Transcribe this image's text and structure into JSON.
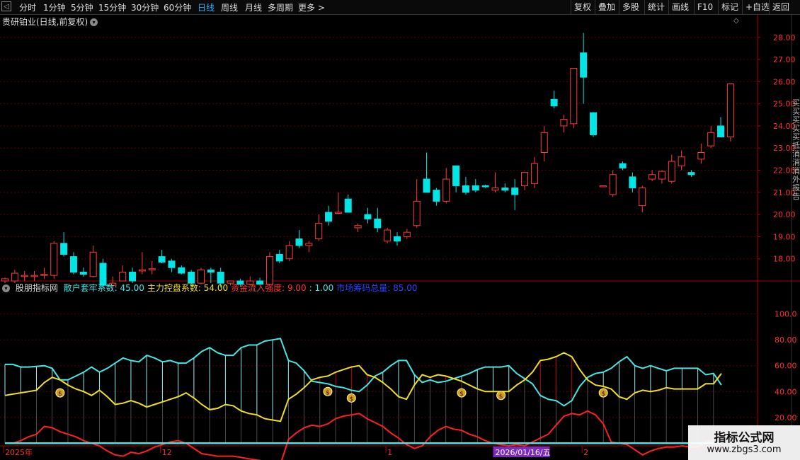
{
  "toolbar": {
    "back_glyph": "◁",
    "periods": [
      {
        "label": "分时",
        "active": false
      },
      {
        "label": "1分钟",
        "active": false
      },
      {
        "label": "5分钟",
        "active": false
      },
      {
        "label": "15分钟",
        "active": false
      },
      {
        "label": "30分钟",
        "active": false
      },
      {
        "label": "60分钟",
        "active": false
      },
      {
        "label": "日线",
        "active": true
      },
      {
        "label": "周线",
        "active": false
      },
      {
        "label": "月线",
        "active": false
      },
      {
        "label": "多周期",
        "active": false
      },
      {
        "label": "更多 >",
        "active": false
      }
    ],
    "right_buttons": [
      "复权",
      "叠加",
      "多股",
      "统计",
      "画线",
      "F10",
      "标记",
      "+自选",
      "返回"
    ]
  },
  "main": {
    "title": "贵研铂业(日线,前复权)",
    "diamond_glyph": "◇"
  },
  "indicator": {
    "name": "股朋指标网",
    "items": [
      {
        "label": "散户套牢系数: 45.00",
        "color": "#44e6e6"
      },
      {
        "label": "主力控盘系数: 54.00",
        "color": "#f0e020"
      },
      {
        "label": "资金流入强度: 9.00",
        "color": "#ff3333"
      },
      {
        "label": ": 1.00",
        "color": "#44e6e6"
      },
      {
        "label": "市场筹码总量: 85.00",
        "color": "#2a44ff"
      }
    ]
  },
  "right_side_text": "买买买买买 抵消消消 外 报 告",
  "watermark": {
    "line1": "指标公式网",
    "line2": "www.zbgs3.com"
  },
  "colors": {
    "up": "#ff3b3b",
    "down": "#00e5e5",
    "grid": "#5a0000",
    "cyan": "#44e6e6",
    "yellow": "#f0e020",
    "red": "#ff2020",
    "axis": "#aa0000"
  },
  "chart_data": {
    "type": "candlestick",
    "price_axis": {
      "ticks": [
        "18.00",
        "19.00",
        "20.00",
        "21.00",
        "22.00",
        "23.00",
        "24.00",
        "25.00",
        "26.00",
        "27.00",
        "28.00"
      ],
      "ylim": [
        17.0,
        28.6
      ]
    },
    "indicator_axis": {
      "ticks": [
        "20.00",
        "40.00",
        "60.00",
        "80.00",
        "100.0"
      ],
      "ylim": [
        -2,
        125
      ]
    },
    "x_labels": [
      {
        "text": "2025年",
        "i": 0
      },
      {
        "text": "12",
        "i": 16
      },
      {
        "text": "1",
        "i": 39
      },
      {
        "text": "2026/01/16/五",
        "i": 50,
        "highlight": true
      },
      {
        "text": "2",
        "i": 59
      }
    ],
    "candles": [
      {
        "o": 17.0,
        "h": 17.15,
        "l": 16.9,
        "c": 17.1
      },
      {
        "o": 17.0,
        "h": 17.5,
        "l": 16.9,
        "c": 17.35
      },
      {
        "o": 17.2,
        "h": 17.45,
        "l": 17.0,
        "c": 17.25
      },
      {
        "o": 17.2,
        "h": 17.45,
        "l": 17.0,
        "c": 17.25
      },
      {
        "o": 17.25,
        "h": 17.6,
        "l": 17.1,
        "c": 17.3
      },
      {
        "o": 17.25,
        "h": 18.8,
        "l": 17.1,
        "c": 18.7
      },
      {
        "o": 18.7,
        "h": 19.2,
        "l": 18.1,
        "c": 18.2
      },
      {
        "o": 18.1,
        "h": 18.3,
        "l": 17.3,
        "c": 17.4
      },
      {
        "o": 17.4,
        "h": 17.6,
        "l": 17.2,
        "c": 17.3
      },
      {
        "o": 17.2,
        "h": 18.6,
        "l": 17.15,
        "c": 18.3
      },
      {
        "o": 17.8,
        "h": 18.0,
        "l": 16.7,
        "c": 16.8
      },
      {
        "o": 16.8,
        "h": 17.2,
        "l": 16.6,
        "c": 16.9
      },
      {
        "o": 17.0,
        "h": 17.7,
        "l": 17.0,
        "c": 17.4
      },
      {
        "o": 17.4,
        "h": 17.6,
        "l": 16.9,
        "c": 17.0
      },
      {
        "o": 17.45,
        "h": 18.3,
        "l": 17.3,
        "c": 17.5
      },
      {
        "o": 17.5,
        "h": 17.9,
        "l": 17.3,
        "c": 17.55
      },
      {
        "o": 18.1,
        "h": 18.4,
        "l": 17.8,
        "c": 17.85
      },
      {
        "o": 17.9,
        "h": 18.0,
        "l": 17.4,
        "c": 17.6
      },
      {
        "o": 17.6,
        "h": 17.7,
        "l": 17.3,
        "c": 17.35
      },
      {
        "o": 17.4,
        "h": 17.5,
        "l": 16.8,
        "c": 16.9
      },
      {
        "o": 16.9,
        "h": 17.6,
        "l": 16.85,
        "c": 17.5
      },
      {
        "o": 17.5,
        "h": 17.6,
        "l": 16.9,
        "c": 17.4
      },
      {
        "o": 17.4,
        "h": 17.6,
        "l": 16.7,
        "c": 16.9
      },
      {
        "o": 16.9,
        "h": 17.0,
        "l": 16.8,
        "c": 17.0
      },
      {
        "o": 17.0,
        "h": 17.1,
        "l": 16.75,
        "c": 16.85
      },
      {
        "o": 16.85,
        "h": 17.2,
        "l": 16.8,
        "c": 17.0
      },
      {
        "o": 17.0,
        "h": 17.15,
        "l": 16.8,
        "c": 16.85
      },
      {
        "o": 16.85,
        "h": 18.3,
        "l": 16.8,
        "c": 18.1
      },
      {
        "o": 18.2,
        "h": 18.4,
        "l": 17.8,
        "c": 17.9
      },
      {
        "o": 18.0,
        "h": 18.8,
        "l": 17.9,
        "c": 18.6
      },
      {
        "o": 18.9,
        "h": 19.3,
        "l": 18.5,
        "c": 18.6
      },
      {
        "o": 18.6,
        "h": 18.8,
        "l": 18.3,
        "c": 18.7
      },
      {
        "o": 18.9,
        "h": 20.0,
        "l": 18.8,
        "c": 19.6
      },
      {
        "o": 20.1,
        "h": 20.4,
        "l": 19.5,
        "c": 19.7
      },
      {
        "o": 20.1,
        "h": 21.0,
        "l": 20.0,
        "c": 20.1
      },
      {
        "o": 20.7,
        "h": 20.9,
        "l": 20.1,
        "c": 20.1
      },
      {
        "o": 19.4,
        "h": 19.6,
        "l": 19.2,
        "c": 19.5
      },
      {
        "o": 20.0,
        "h": 20.3,
        "l": 19.6,
        "c": 19.8
      },
      {
        "o": 19.8,
        "h": 20.3,
        "l": 19.2,
        "c": 19.4
      },
      {
        "o": 18.8,
        "h": 19.4,
        "l": 18.7,
        "c": 19.3
      },
      {
        "o": 19.0,
        "h": 19.2,
        "l": 18.6,
        "c": 18.8
      },
      {
        "o": 19.0,
        "h": 19.35,
        "l": 18.9,
        "c": 19.2
      },
      {
        "o": 19.5,
        "h": 21.6,
        "l": 19.4,
        "c": 20.6
      },
      {
        "o": 21.6,
        "h": 22.8,
        "l": 21.0,
        "c": 21.0
      },
      {
        "o": 21.1,
        "h": 21.2,
        "l": 20.4,
        "c": 20.6
      },
      {
        "o": 20.6,
        "h": 22.1,
        "l": 20.5,
        "c": 21.6
      },
      {
        "o": 22.2,
        "h": 22.2,
        "l": 21.0,
        "c": 21.3
      },
      {
        "o": 21.3,
        "h": 21.7,
        "l": 20.9,
        "c": 21.0
      },
      {
        "o": 21.3,
        "h": 21.6,
        "l": 21.0,
        "c": 21.1
      },
      {
        "o": 21.3,
        "h": 21.35,
        "l": 21.2,
        "c": 21.25
      },
      {
        "o": 21.1,
        "h": 21.9,
        "l": 21.0,
        "c": 21.2
      },
      {
        "o": 21.2,
        "h": 21.4,
        "l": 21.0,
        "c": 21.1
      },
      {
        "o": 21.2,
        "h": 21.6,
        "l": 20.2,
        "c": 20.9
      },
      {
        "o": 21.3,
        "h": 21.9,
        "l": 21.1,
        "c": 21.9
      },
      {
        "o": 21.4,
        "h": 22.6,
        "l": 21.2,
        "c": 22.3
      },
      {
        "o": 22.8,
        "h": 24.0,
        "l": 22.4,
        "c": 23.7
      },
      {
        "o": 25.2,
        "h": 25.6,
        "l": 24.8,
        "c": 24.9
      },
      {
        "o": 24.0,
        "h": 24.5,
        "l": 23.7,
        "c": 24.3
      },
      {
        "o": 24.1,
        "h": 26.6,
        "l": 23.9,
        "c": 26.6
      },
      {
        "o": 27.3,
        "h": 28.2,
        "l": 25.0,
        "c": 26.2
      },
      {
        "o": 24.6,
        "h": 24.6,
        "l": 23.5,
        "c": 23.6
      },
      {
        "o": 21.3,
        "h": 21.3,
        "l": 21.25,
        "c": 21.3
      },
      {
        "o": 20.9,
        "h": 22.0,
        "l": 20.8,
        "c": 21.8
      },
      {
        "o": 22.3,
        "h": 22.4,
        "l": 22.0,
        "c": 22.1
      },
      {
        "o": 21.7,
        "h": 21.9,
        "l": 21.0,
        "c": 21.2
      },
      {
        "o": 20.4,
        "h": 21.3,
        "l": 20.1,
        "c": 21.2
      },
      {
        "o": 21.6,
        "h": 22.0,
        "l": 21.5,
        "c": 21.8
      },
      {
        "o": 21.6,
        "h": 22.0,
        "l": 21.4,
        "c": 21.95
      },
      {
        "o": 21.5,
        "h": 22.7,
        "l": 21.4,
        "c": 22.4
      },
      {
        "o": 22.2,
        "h": 22.9,
        "l": 22.0,
        "c": 22.6
      },
      {
        "o": 21.9,
        "h": 22.0,
        "l": 21.7,
        "c": 21.8
      },
      {
        "o": 22.5,
        "h": 23.2,
        "l": 22.3,
        "c": 22.8
      },
      {
        "o": 23.1,
        "h": 24.0,
        "l": 23.0,
        "c": 23.7
      },
      {
        "o": 24.0,
        "h": 24.4,
        "l": 23.6,
        "c": 23.5
      },
      {
        "o": 23.5,
        "h": 25.9,
        "l": 23.3,
        "c": 25.9
      }
    ],
    "indicator_bar_every": 2,
    "series": [
      {
        "name": "散户套牢系数",
        "color": "#44e6e6",
        "values": [
          61.0,
          61.0,
          59.0,
          59.0,
          59.5,
          60.0,
          58.0,
          49.0,
          49.0,
          52.0,
          55.0,
          59.0,
          55.0,
          58.0,
          62.0,
          66.0,
          64.0,
          63.0,
          68.0,
          66.0,
          63.0,
          64.0,
          62.0,
          62.0,
          66.0,
          71.0,
          74.0,
          70.0,
          68.0,
          68.0,
          74.0,
          76.0,
          76.0,
          79.0,
          80.0,
          81.0,
          64.0,
          62.0,
          56.0,
          48.0,
          47.0,
          46.0,
          44.0,
          43.0,
          41.0,
          40.0,
          45.0,
          52.0,
          55.0,
          60.0,
          64.0,
          64.0,
          53.0,
          47.0,
          49.0,
          47.0,
          48.0,
          50.0,
          52.0,
          54.0,
          57.0,
          59.0,
          59.0,
          59.0,
          60.0,
          54.0,
          50.0,
          46.0,
          37.0,
          34.0,
          33.0,
          29.0,
          33.0,
          44.0,
          51.0,
          54.0,
          55.0,
          58.0,
          63.0,
          67.0,
          60.0,
          58.0,
          60.0,
          58.0,
          56.0,
          58.0,
          58.0,
          58.0,
          58.0,
          53.0,
          54.0,
          45.0
        ]
      },
      {
        "name": "主力控盘系数",
        "color": "#f0e020",
        "values": [
          37.0,
          38.0,
          39.0,
          40.0,
          41.0,
          47.0,
          51.0,
          49.0,
          45.0,
          42.0,
          40.0,
          37.0,
          41.0,
          36.0,
          30.0,
          31.0,
          33.0,
          31.0,
          28.0,
          30.0,
          32.0,
          34.0,
          36.0,
          39.0,
          35.0,
          30.0,
          26.0,
          27.0,
          30.0,
          29.0,
          25.0,
          23.0,
          22.0,
          19.0,
          18.0,
          17.0,
          34.0,
          38.0,
          43.0,
          49.0,
          51.0,
          52.0,
          55.0,
          57.0,
          59.0,
          60.0,
          53.0,
          51.0,
          47.0,
          42.0,
          36.0,
          34.0,
          45.0,
          53.0,
          51.0,
          53.0,
          52.0,
          50.0,
          48.0,
          45.0,
          42.0,
          40.0,
          40.0,
          40.0,
          40.0,
          45.0,
          49.0,
          55.0,
          64.0,
          65.0,
          67.0,
          70.0,
          67.0,
          57.0,
          49.0,
          45.0,
          44.0,
          42.0,
          36.0,
          34.0,
          39.0,
          41.0,
          40.0,
          41.0,
          43.0,
          42.0,
          42.0,
          42.0,
          42.0,
          46.0,
          46.0,
          54.0
        ]
      },
      {
        "name": "资金流入强度",
        "color": "#ff2020",
        "values": [
          0.0,
          0.0,
          2.0,
          5.0,
          7.0,
          13.0,
          12.0,
          9.0,
          7.0,
          5.0,
          2.0,
          0.0,
          -2.0,
          -6.0,
          -9.0,
          -10.0,
          -7.0,
          -8.0,
          -6.0,
          -3.0,
          -1.0,
          1.0,
          2.0,
          0.0,
          -4.0,
          -8.0,
          -9.0,
          -10.0,
          -10.0,
          -10.0,
          -11.0,
          -12.0,
          -13.0,
          -14.0,
          -15.0,
          -16.0,
          3.0,
          8.0,
          12.0,
          14.0,
          13.0,
          15.0,
          19.0,
          21.0,
          22.0,
          23.0,
          19.0,
          16.0,
          13.0,
          8.0,
          4.0,
          -1.0,
          -4.0,
          -2.0,
          5.0,
          10.0,
          13.0,
          11.0,
          10.0,
          7.0,
          5.0,
          2.0,
          0.0,
          -1.0,
          -2.0,
          -1.0,
          -2.0,
          1.0,
          4.0,
          7.0,
          14.0,
          21.0,
          23.0,
          22.0,
          25.0,
          22.0,
          15.0,
          1.0,
          0.0,
          -1.0,
          -5.0,
          -9.0,
          -6.0,
          -4.0,
          -3.0,
          -3.0,
          -2.0,
          -3.0,
          -3.0,
          1.0,
          2.0,
          9.0
        ]
      },
      {
        "name": "",
        "color": "#44e6e6",
        "values": [
          0.0,
          0.0,
          0.0,
          0.0,
          0.0,
          0.0,
          0.0,
          0.0,
          0.0,
          0.0,
          0.0,
          0.0,
          0.0,
          0.0,
          0.0,
          0.0,
          0.0,
          0.0,
          0.0,
          0.0,
          0.0,
          0.0,
          0.0,
          0.0,
          0.0,
          0.0,
          0.0,
          0.0,
          0.0,
          0.0,
          0.0,
          0.0,
          0.0,
          0.0,
          0.0,
          0.0,
          0.0,
          0.0,
          0.0,
          0.0,
          0.0,
          0.0,
          0.0,
          0.0,
          0.0,
          0.0,
          0.0,
          0.0,
          0.0,
          0.0,
          0.0,
          0.0,
          0.0,
          0.0,
          0.0,
          0.0,
          0.0,
          0.0,
          0.0,
          0.0,
          0.0,
          0.0,
          0.0,
          0.0,
          0.0,
          0.0,
          0.0,
          0.0,
          0.0,
          0.0,
          0.0,
          0.0,
          0.0,
          0.0,
          0.0,
          0.0,
          0.0,
          0.0,
          0.0,
          0.0,
          0.0,
          0.0,
          0.0,
          0.0,
          0.0,
          0.0,
          0.0,
          0.0,
          0.0,
          0.0,
          0.0,
          0.0
        ]
      }
    ],
    "buy_signals": [
      {
        "i": 7,
        "v": 39
      },
      {
        "i": 41,
        "v": 40
      },
      {
        "i": 44,
        "v": 35
      },
      {
        "i": 58,
        "v": 39
      },
      {
        "i": 63,
        "v": 37
      },
      {
        "i": 76,
        "v": 39
      },
      {
        "i": 104,
        "v": 36
      }
    ]
  }
}
